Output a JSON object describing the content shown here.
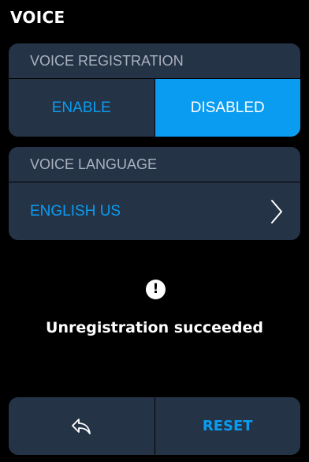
{
  "header": {
    "title": "VOICE"
  },
  "registration": {
    "section_label": "VOICE REGISTRATION",
    "enable_label": "ENABLE",
    "disabled_label": "DISABLED",
    "selected": "DISABLED"
  },
  "language": {
    "section_label": "VOICE LANGUAGE",
    "value": "ENGLISH US"
  },
  "status": {
    "icon": "alert-circle-icon",
    "message": "Unregistration succeeded"
  },
  "footer": {
    "back_icon": "back-arrow-icon",
    "reset_label": "RESET"
  },
  "colors": {
    "background": "#000000",
    "card": "#253347",
    "accent": "#0a9cf0",
    "section_text": "#a9b1bd",
    "text": "#ffffff"
  }
}
